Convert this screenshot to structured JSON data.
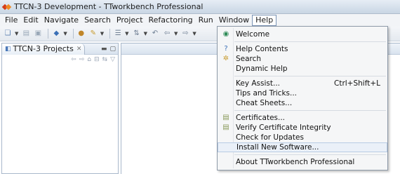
{
  "window": {
    "title": "TTCN-3 Development - TTworkbench Professional"
  },
  "menubar": {
    "items": [
      {
        "label": "File"
      },
      {
        "label": "Edit"
      },
      {
        "label": "Navigate"
      },
      {
        "label": "Search"
      },
      {
        "label": "Project"
      },
      {
        "label": "Refactoring"
      },
      {
        "label": "Run"
      },
      {
        "label": "Window"
      },
      {
        "label": "Help"
      }
    ]
  },
  "view": {
    "tab_label": "TTCN-3 Projects",
    "tab_close_glyph": "✕"
  },
  "help_menu": {
    "welcome": "Welcome",
    "help_contents": "Help Contents",
    "search": "Search",
    "dynamic_help": "Dynamic Help",
    "key_assist": "Key Assist...",
    "key_assist_accel": "Ctrl+Shift+L",
    "tips_and_tricks": "Tips and Tricks...",
    "cheat_sheets": "Cheat Sheets...",
    "certificates": "Certificates...",
    "verify_certificate": "Verify Certificate Integrity",
    "check_for_updates": "Check for Updates",
    "install_new_software": "Install New Software...",
    "about": "About TTworkbench Professional"
  },
  "colors": {
    "accent": "#4b78b8",
    "menu_highlight": "#eaf0f8"
  }
}
